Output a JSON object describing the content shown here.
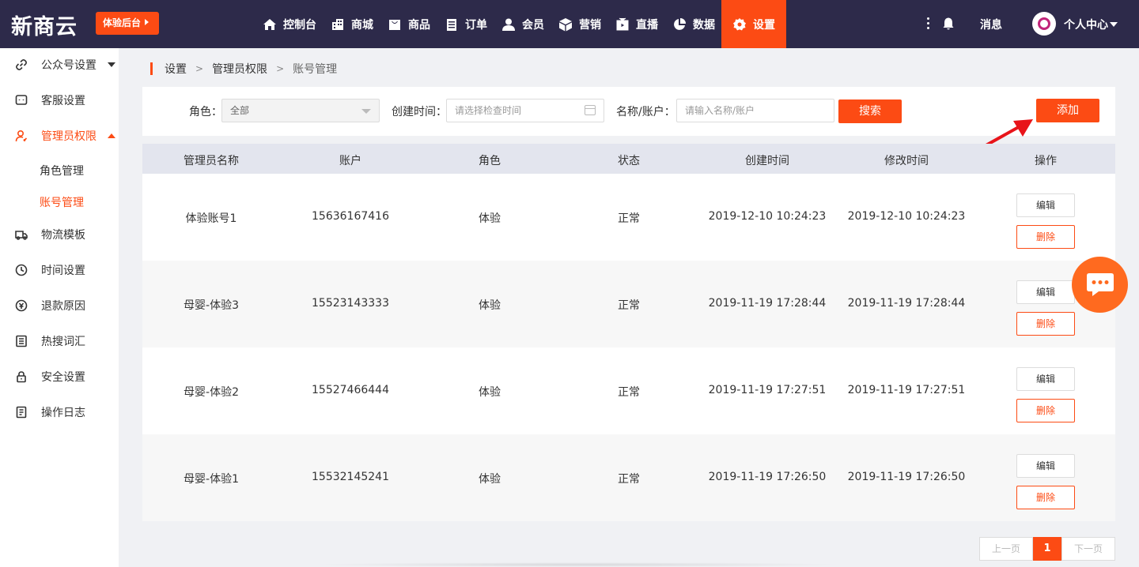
{
  "app": {
    "logo": "新商云",
    "trial_button": "体验后台"
  },
  "nav": [
    {
      "label": "控制台",
      "icon": "home-icon"
    },
    {
      "label": "商城",
      "icon": "building-icon"
    },
    {
      "label": "商品",
      "icon": "bag-icon"
    },
    {
      "label": "订单",
      "icon": "clipboard-icon"
    },
    {
      "label": "会员",
      "icon": "user-icon"
    },
    {
      "label": "营销",
      "icon": "cube-icon"
    },
    {
      "label": "直播",
      "icon": "tv-icon"
    },
    {
      "label": "数据",
      "icon": "pie-icon"
    },
    {
      "label": "设置",
      "icon": "gear-icon",
      "active": true
    }
  ],
  "topright": {
    "messages": "消息",
    "personal": "个人中心"
  },
  "sidebar": {
    "items": [
      {
        "label": "公众号设置",
        "icon": "link-icon"
      },
      {
        "label": "客服设置",
        "icon": "chat-icon"
      },
      {
        "label": "管理员权限",
        "icon": "admin-icon"
      },
      {
        "label": "物流模板",
        "icon": "truck-icon"
      },
      {
        "label": "时间设置",
        "icon": "clock-icon"
      },
      {
        "label": "退款原因",
        "icon": "refund-icon"
      },
      {
        "label": "热搜词汇",
        "icon": "list-icon"
      },
      {
        "label": "安全设置",
        "icon": "lock-icon"
      },
      {
        "label": "操作日志",
        "icon": "log-icon"
      }
    ],
    "subitems": [
      {
        "label": "角色管理"
      },
      {
        "label": "账号管理",
        "active": true
      }
    ]
  },
  "breadcrumb": [
    "设置",
    "管理员权限",
    "账号管理"
  ],
  "filter": {
    "role_label": "角色：",
    "role_value": "全部",
    "time_label": "创建时间：",
    "time_placeholder": "请选择检查时间",
    "name_label": "名称/账户：",
    "name_placeholder": "请输入名称/账户",
    "search_button": "搜索",
    "add_button": "添加"
  },
  "table": {
    "columns": [
      "管理员名称",
      "账户",
      "角色",
      "状态",
      "创建时间",
      "修改时间",
      "操作"
    ],
    "rows": [
      {
        "name": "体验账号1",
        "account": "15636167416",
        "role": "体验",
        "status": "正常",
        "created": "2019-12-10 10:24:23",
        "modified": "2019-12-10 10:24:23"
      },
      {
        "name": "母婴-体验3",
        "account": "15523143333",
        "role": "体验",
        "status": "正常",
        "created": "2019-11-19 17:28:44",
        "modified": "2019-11-19 17:28:44"
      },
      {
        "name": "母婴-体验2",
        "account": "15527466444",
        "role": "体验",
        "status": "正常",
        "created": "2019-11-19 17:27:51",
        "modified": "2019-11-19 17:27:51"
      },
      {
        "name": "母婴-体验1",
        "account": "15532145241",
        "role": "体验",
        "status": "正常",
        "created": "2019-11-19 17:26:50",
        "modified": "2019-11-19 17:26:50"
      }
    ],
    "edit_label": "编辑",
    "delete_label": "删除"
  },
  "pagination": {
    "prev": "上一页",
    "current": "1",
    "next": "下一页"
  },
  "colors": {
    "accent": "#fc4b14",
    "topbar": "#2d2a4a",
    "annotation_arrow": "#e8141a"
  }
}
